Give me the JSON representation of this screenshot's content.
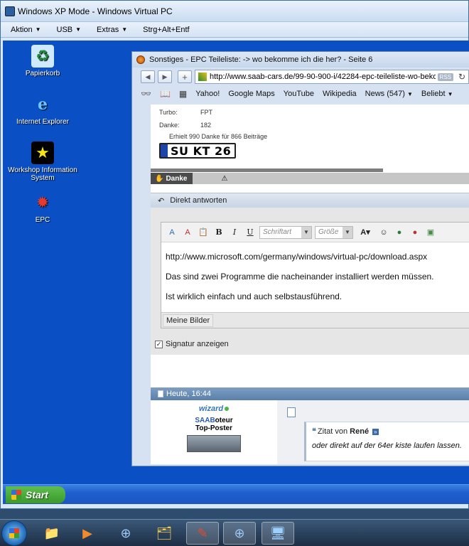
{
  "vpc": {
    "title": "Windows XP Mode - Windows Virtual PC",
    "menu": [
      {
        "label": "Aktion"
      },
      {
        "label": "USB"
      },
      {
        "label": "Extras"
      },
      {
        "label": "Strg+Alt+Entf"
      }
    ]
  },
  "desktop_icons": [
    {
      "label": "Papierkorb",
      "icon": "recycle-bin-icon"
    },
    {
      "label": "Internet Explorer",
      "icon": "internet-explorer-icon"
    },
    {
      "label": "Workshop Information System",
      "icon": "wis-icon"
    },
    {
      "label": "EPC",
      "icon": "epc-icon"
    }
  ],
  "firefox": {
    "title": "Sonstiges - EPC Teileliste: -> wo bekomme ich die her? - Seite 6",
    "url": "http://www.saab-cars.de/99-90-900-i/42284-epc-teileliste-wo-bekon",
    "rss": "RSS",
    "bookmarks": [
      "Yahoo!",
      "Google Maps",
      "YouTube",
      "Wikipedia",
      "News (547)",
      "Beliebt"
    ]
  },
  "profile": {
    "turbo_label": "Turbo:",
    "turbo_value": "FPT",
    "danke_label": "Danke:",
    "danke_value": "182",
    "thanks_line": "Erhielt 990 Danke für 866 Beiträge",
    "plate": "SU KT 26"
  },
  "danke_button": "Danke",
  "reply": {
    "header": "Direkt antworten",
    "font_placeholder": "Schriftart",
    "size_placeholder": "Größe",
    "lines": [
      "http://www.microsoft.com/germany/windows/virtual-pc/download.aspx",
      "Das sind zwei Programme die nacheinander installiert werden müssen.",
      "Ist wirklich einfach und auch selbstausführend."
    ],
    "my_images": "Meine Bilder",
    "signature": "Signatur anzeigen"
  },
  "post": {
    "date": "Heute, 16:44",
    "author": "wizard",
    "rank_prefix": "SAAB",
    "rank_suffix": "oteur",
    "rank2": "Top-Poster",
    "quote_prefix": "Zitat von",
    "quote_author": "René",
    "quote_text": "oder direkt auf der 64er kiste laufen lassen."
  },
  "xp_taskbar": {
    "start": "Start"
  },
  "colors": {
    "xp_desktop": "#0a4fc4",
    "accent": "#3777b8"
  }
}
